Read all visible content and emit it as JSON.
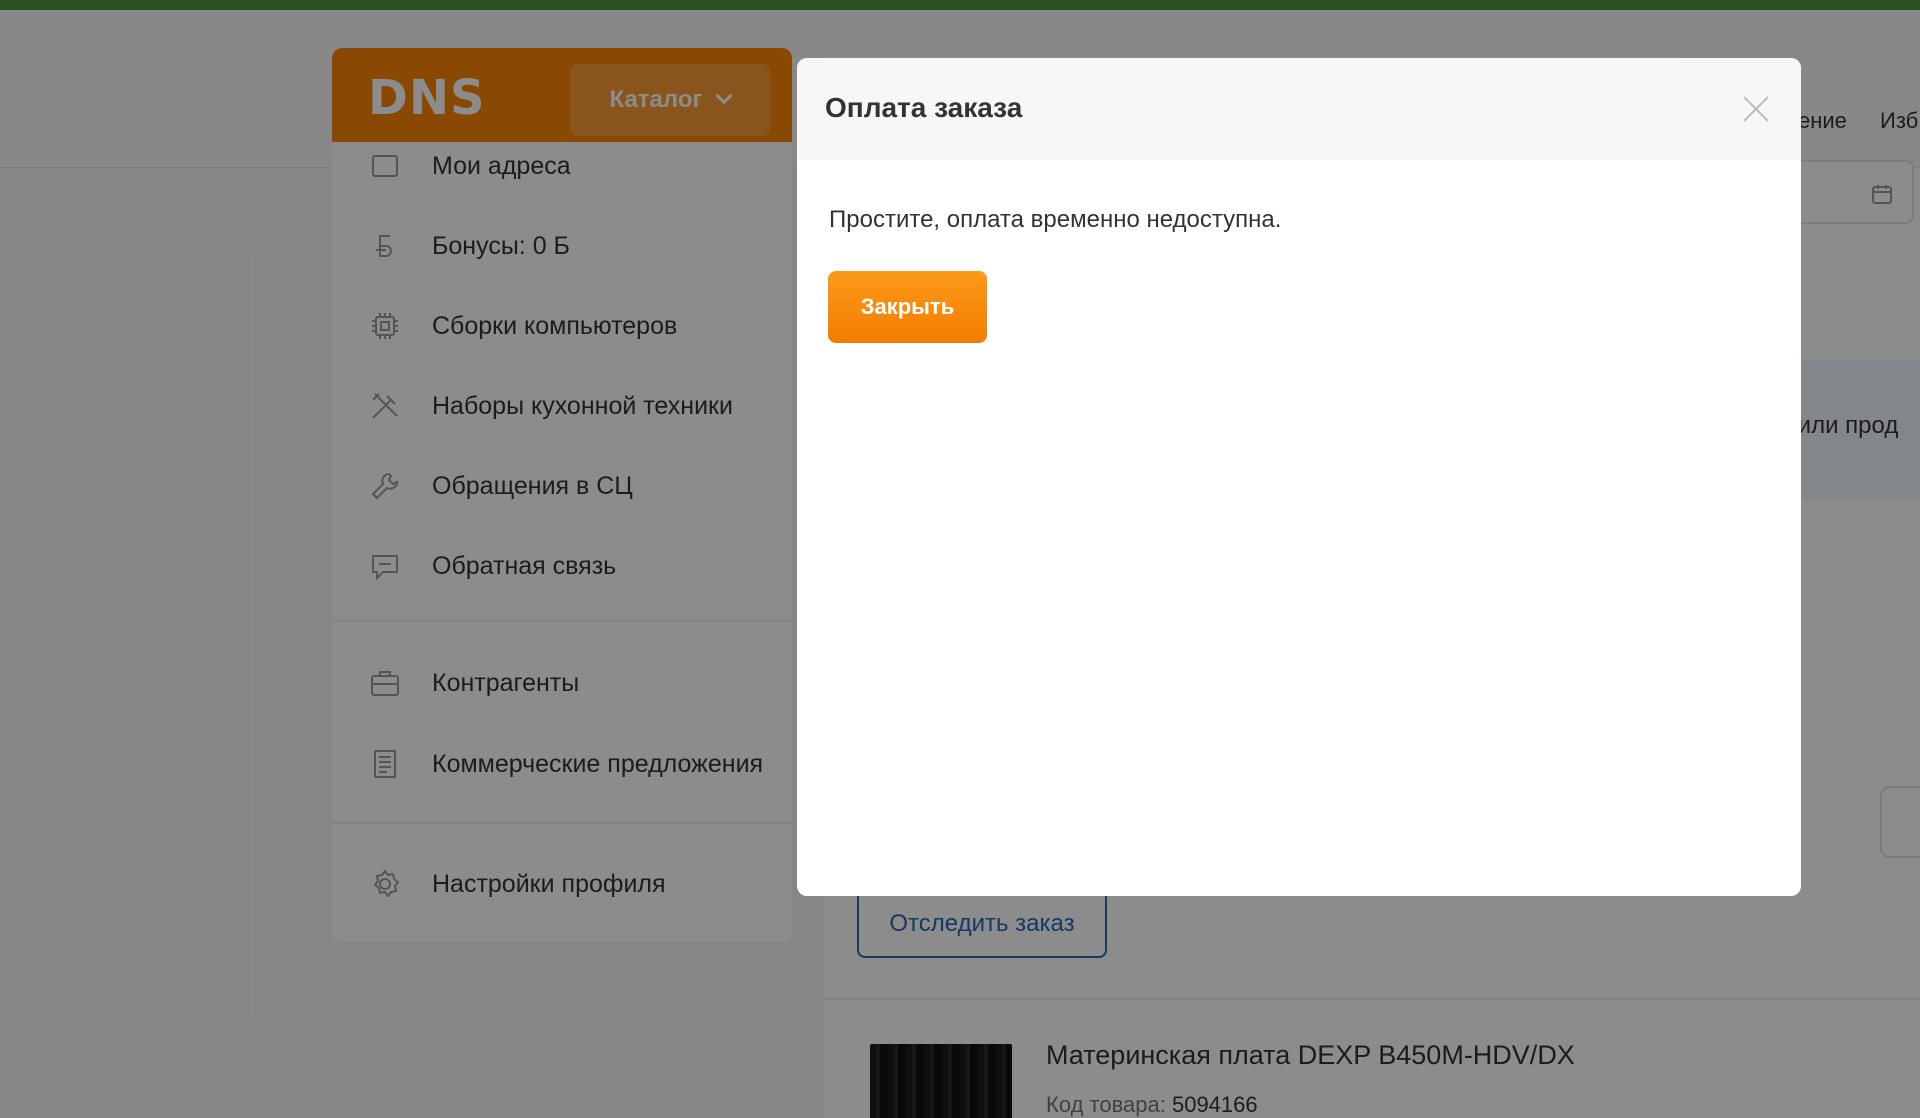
{
  "header": {
    "logo": "DNS",
    "catalog_label": "Каталог",
    "link_partial_1": "ение",
    "link_partial_2": "Изб"
  },
  "sidebar": {
    "items": [
      {
        "label": "Мои адреса",
        "icon": "map-icon"
      },
      {
        "label": "Бонусы: 0 Б",
        "icon": "bonus-icon"
      },
      {
        "label": "Сборки компьютеров",
        "icon": "chip-icon"
      },
      {
        "label": "Наборы кухонной техники",
        "icon": "kitchen-icon"
      },
      {
        "label": "Обращения в СЦ",
        "icon": "wrench-icon"
      },
      {
        "label": "Обратная связь",
        "icon": "chat-icon"
      },
      {
        "label": "Контрагенты",
        "icon": "briefcase-icon"
      },
      {
        "label": "Коммерческие предложения",
        "icon": "document-icon"
      },
      {
        "label": "Настройки профиля",
        "icon": "gear-icon"
      }
    ]
  },
  "main": {
    "info_text_partial": "я или прод",
    "track_button": "Отследить заказ",
    "product": {
      "title": "Материнская плата DEXP B450M-HDV/DX",
      "code_label": "Код товара:",
      "code_value": "5094166"
    }
  },
  "modal": {
    "title": "Оплата заказа",
    "message": "Простите, оплата временно недоступна.",
    "close_button": "Закрыть"
  },
  "colors": {
    "brand_orange": "#fc8507",
    "top_stripe": "#4c9a3e",
    "link_blue": "#2a66b3"
  }
}
